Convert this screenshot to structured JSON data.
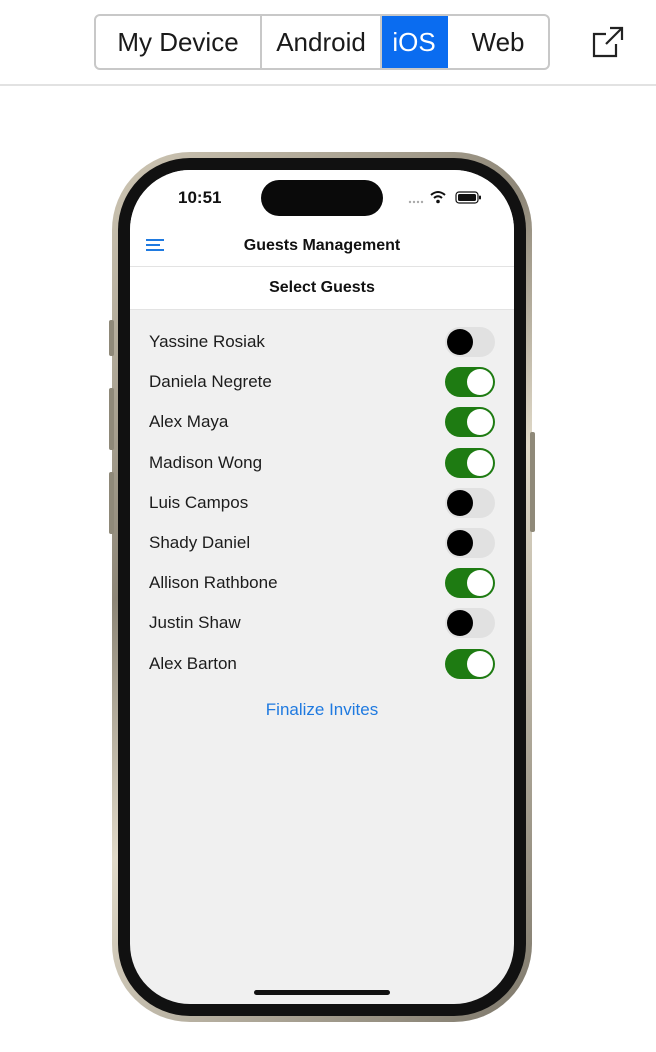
{
  "platform_switcher": {
    "options": [
      {
        "label": "My Device",
        "active": false
      },
      {
        "label": "Android",
        "active": false
      },
      {
        "label": "iOS",
        "active": true
      },
      {
        "label": "Web",
        "active": false
      }
    ],
    "external_link_icon": "open-external-icon"
  },
  "status_bar": {
    "time": "10:51",
    "icons": [
      "signal-icon",
      "wifi-icon",
      "battery-icon"
    ]
  },
  "nav": {
    "title": "Guests Management",
    "menu_icon": "hamburger-menu-icon"
  },
  "section": {
    "title": "Select Guests"
  },
  "guests": [
    {
      "name": "Yassine Rosiak",
      "selected": false
    },
    {
      "name": "Daniela Negrete",
      "selected": true
    },
    {
      "name": "Alex Maya",
      "selected": true
    },
    {
      "name": "Madison Wong",
      "selected": true
    },
    {
      "name": "Luis Campos",
      "selected": false
    },
    {
      "name": "Shady Daniel",
      "selected": false
    },
    {
      "name": "Allison Rathbone",
      "selected": true
    },
    {
      "name": "Justin Shaw",
      "selected": false
    },
    {
      "name": "Alex Barton",
      "selected": true
    }
  ],
  "actions": {
    "finalize_label": "Finalize Invites"
  },
  "colors": {
    "active_segment": "#0a6cf0",
    "toggle_on": "#1e7b12",
    "link": "#1f7ae0"
  }
}
